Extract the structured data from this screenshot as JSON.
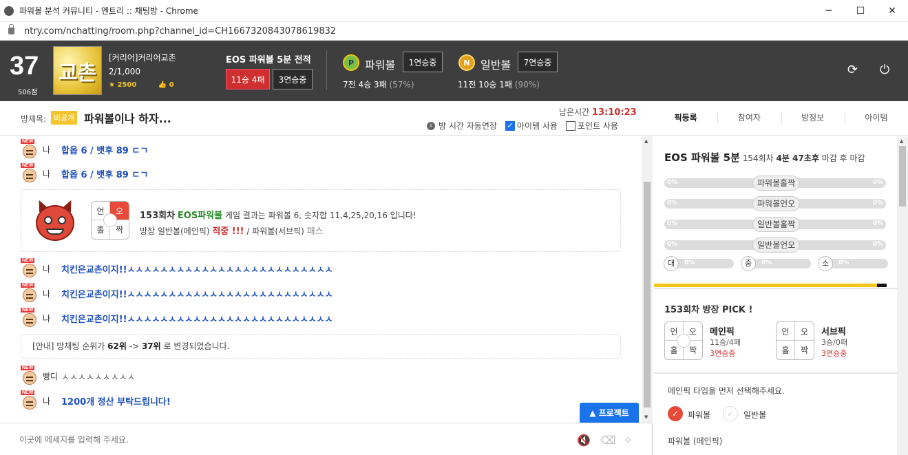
{
  "window": {
    "title": "파워볼 분석 커뮤니티 - 엔트리 :: 채팅방 - Chrome",
    "url": "ntry.com/nchatting/room.php?channel_id=CH1667320843078619832",
    "minimize": "─",
    "maximize": "☐",
    "close": "✕"
  },
  "header": {
    "rank": "37",
    "points": "506점",
    "avatar_text": "교촌",
    "username": "[커리어]커리어교촌",
    "member_count": "2/1,000",
    "stars": "2500",
    "likes": "0",
    "eos_title": "EOS 파워볼 5분 전적",
    "eos_record": "11승 4패",
    "eos_streak": "3연승중",
    "powerball": {
      "icon": "P",
      "title": "파워볼",
      "streak": "1연승중",
      "record": "7전 4승 3패",
      "pct": "(57%)"
    },
    "normalball": {
      "icon": "N",
      "title": "일반볼",
      "streak": "7연승중",
      "record": "11전 10승 1패",
      "pct": "(90%)"
    },
    "refresh_icon": "⟳",
    "power_icon": "⏻"
  },
  "room": {
    "label": "방제목:",
    "private_badge": "비공개",
    "title": "파워볼이나 하자...",
    "remaining_label": "남은시간",
    "remaining_time": "13:10:23",
    "auto_extend": "방 시간 자동연장",
    "item_use": "아이템 사용",
    "point_use": "포인트 사용",
    "tabs": [
      "픽등록",
      "참여자",
      "방정보",
      "아이템"
    ]
  },
  "chat": {
    "new_badge": "NEW",
    "messages": [
      {
        "name": "나",
        "text": "합옵 6 / 뱃후 89 ㄷㄱ"
      },
      {
        "name": "나",
        "text": "합옵 6 / 뱃후 89 ㄷㄱ"
      },
      {
        "name": "나",
        "text": "치킨은교촌이지!!ㅅㅅㅅㅅㅅㅅㅅㅅㅅㅅㅅㅅㅅㅅㅅㅅㅅㅅㅅㅅㅅㅅㅅㅅㅅ"
      },
      {
        "name": "나",
        "text": "치킨은교촌이지!!ㅅㅅㅅㅅㅅㅅㅅㅅㅅㅅㅅㅅㅅㅅㅅㅅㅅㅅㅅㅅㅅㅅㅅㅅㅅ"
      },
      {
        "name": "나",
        "text": "치킨은교촌이지!!ㅅㅅㅅㅅㅅㅅㅅㅅㅅㅅㅅㅅㅅㅅㅅㅅㅅㅅㅅㅅㅅㅅㅅㅅㅅ"
      },
      {
        "name": "빵디",
        "text": "ㅅㅅㅅㅅㅅㅅㅅㅅㅅ"
      },
      {
        "name": "나",
        "text": "1200개 정산 부탁드립니다!"
      }
    ],
    "result": {
      "grid": [
        "언",
        "오",
        "홀",
        "짝"
      ],
      "round": "153회차",
      "game": "EOS파워볼",
      "text": "게임 결과는 파워볼 6, 숫자합 11,4,25,20,16 입니다!",
      "line2_a": "방장 일반볼(메인픽)",
      "hit": "적중 !!!",
      "line2_b": "/ 파워볼(서브픽)",
      "pass": "패스"
    },
    "notice": {
      "prefix": "[안내] 방채팅 순위가",
      "from": "62위",
      "arrow": "->",
      "to": "37위",
      "suffix": "로 변경되었습니다."
    },
    "promo_button": "▲ 프로젝트",
    "input_placeholder": "이곳에 메세지를 입력해 주세요.",
    "mute_icon": "🔇",
    "eraser_icon": "⌫",
    "magic_icon": "✧"
  },
  "panel": {
    "title": "EOS 파워볼 5분",
    "round": "154회차",
    "countdown": "4분 47초후",
    "close_text": "마감 후 마감",
    "bars": [
      {
        "label": "파워볼홀짝",
        "left": "0%",
        "right": "0%"
      },
      {
        "label": "파워볼언오",
        "left": "0%",
        "right": "0%"
      },
      {
        "label": "일반볼홀짝",
        "left": "0%",
        "right": "0%"
      },
      {
        "label": "일반볼언오",
        "left": "0%",
        "right": "0%"
      }
    ],
    "sizes": [
      {
        "label": "대",
        "value": "0%"
      },
      {
        "label": "중",
        "value": "0%"
      },
      {
        "label": "소",
        "value": "0%"
      }
    ],
    "pick_title": "153회차 방장 PICK !",
    "main_pick": {
      "grid": [
        "언",
        "오",
        "홀",
        "짝"
      ],
      "name": "메인픽",
      "record": "11승/4패",
      "streak": "3연승중"
    },
    "sub_pick": {
      "grid": [
        "언",
        "오",
        "홀",
        "짝"
      ],
      "name": "서브픽",
      "record": "3승/0패",
      "streak": "3연승중"
    },
    "hint": "메인픽 타입을 먼저 선택해주세요.",
    "options": [
      "파워볼",
      "일반볼"
    ],
    "check_mark": "✓",
    "sub_label": "파워볼 (메인픽)"
  }
}
